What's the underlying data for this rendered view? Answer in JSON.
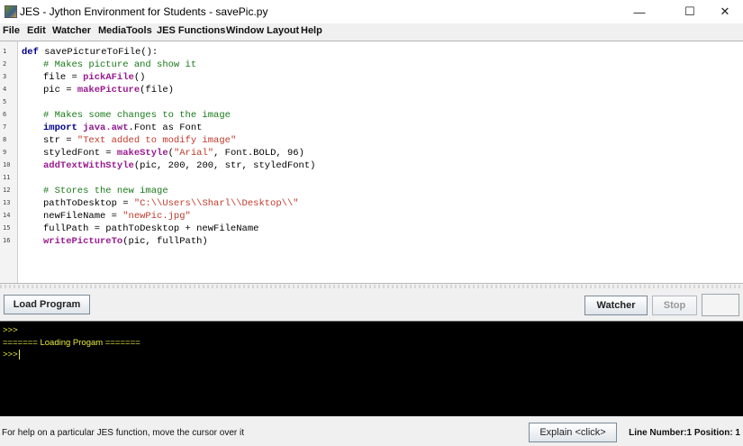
{
  "window": {
    "title": "JES - Jython Environment for Students - savePic.py",
    "minimize": "—",
    "maximize": "☐",
    "close": "✕"
  },
  "menu": [
    "File",
    "Edit",
    "Watcher",
    "MediaTools",
    "JES Functions",
    "Window Layout",
    "Help"
  ],
  "editor": {
    "lines": [
      "1",
      "2",
      "3",
      "4",
      "5",
      "6",
      "7",
      "8",
      "9",
      "10",
      "11",
      "12",
      "13",
      "14",
      "15",
      "16"
    ],
    "code": {
      "l1_kw": "def",
      "l1_rest": " savePictureToFile():",
      "l2": "# Makes picture and show it",
      "l3_a": "file = ",
      "l3_fn": "pickAFile",
      "l3_b": "()",
      "l4_a": "pic = ",
      "l4_fn": "makePicture",
      "l4_b": "(file)",
      "l6": "# Makes some changes to the image",
      "l7_kw": "import",
      "l7_mod": " java.awt",
      "l7_rest": ".Font as Font",
      "l8_a": "str = ",
      "l8_st": "\"Text added to modify image\"",
      "l9_a": "styledFont = ",
      "l9_fn": "makeStyle",
      "l9_b": "(",
      "l9_st": "\"Arial\"",
      "l9_c": ", Font.BOLD, 96)",
      "l10_fn": "addTextWithStyle",
      "l10_b": "(pic, 200, 200, str, styledFont)",
      "l12": "# Stores the new image",
      "l13_a": "pathToDesktop = ",
      "l13_st": "\"C:\\\\Users\\\\Sharl\\\\Desktop\\\\\"",
      "l14_a": "newFileName = ",
      "l14_st": "\"newPic.jpg\"",
      "l15": "fullPath = pathToDesktop + newFileName",
      "l16_fn": "writePictureTo",
      "l16_b": "(pic, fullPath)"
    }
  },
  "toolbar": {
    "load_program": "Load Program",
    "watcher": "Watcher",
    "stop": "Stop",
    "extra": ""
  },
  "console": {
    "line1": ">>>",
    "line2": "======= Loading Progam =======",
    "line3": ">>>"
  },
  "status": {
    "help_text": "For help on a particular JES function, move the cursor over it",
    "explain": "Explain <click>",
    "position": "Line Number:1 Position: 1"
  },
  "colors": {
    "keyword": "#00008b",
    "function": "#9b1a8f",
    "comment": "#1a7a1a",
    "string": "#c0392b",
    "console_text": "#e8e840",
    "console_bg": "#000000"
  }
}
